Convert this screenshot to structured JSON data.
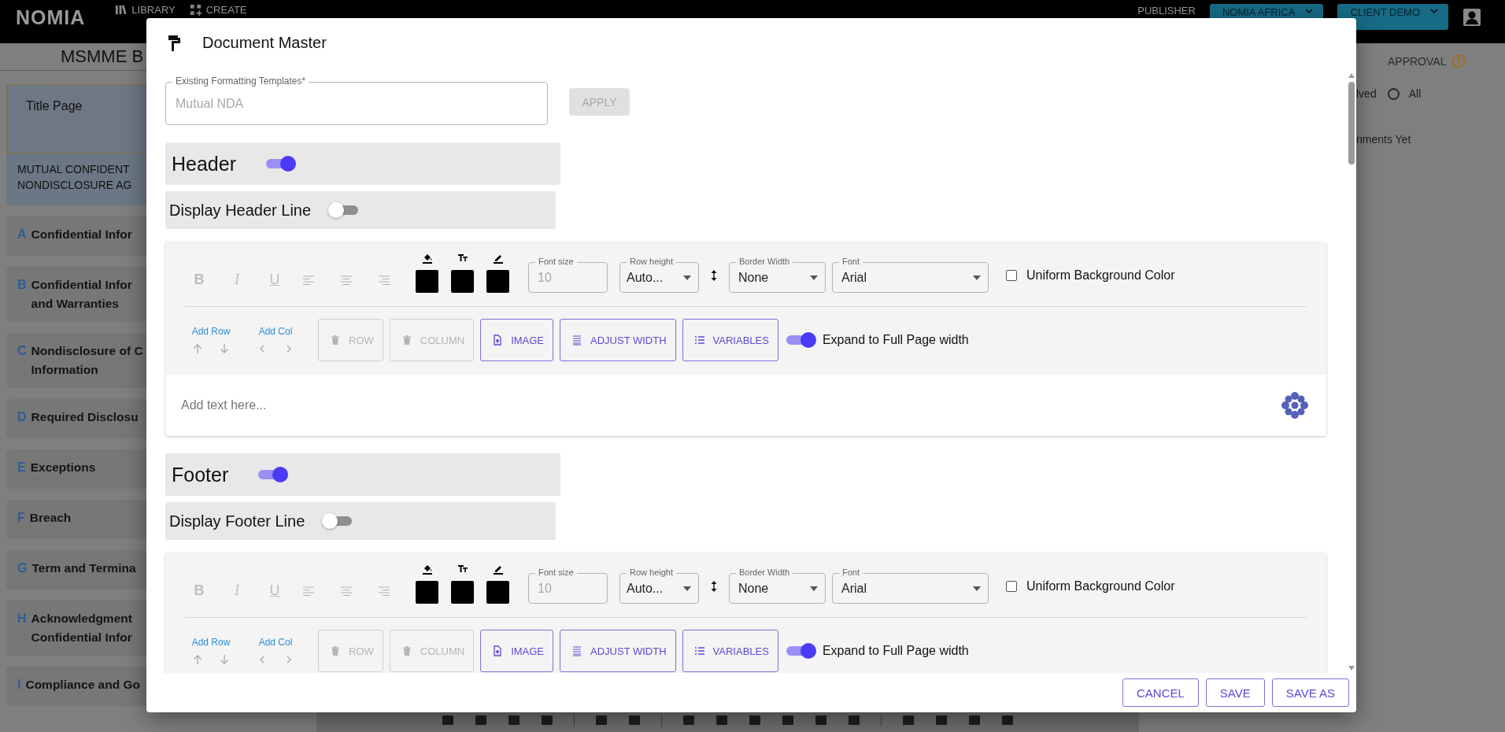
{
  "app_bar": {
    "logo": "NOMIA",
    "nav": [
      {
        "label": "LIBRARY"
      },
      {
        "label": "CREATE"
      }
    ],
    "role": "PUBLISHER",
    "menus": [
      {
        "label": "NOMIA AFRICA"
      },
      {
        "label": "CLIENT DEMO"
      }
    ]
  },
  "document": {
    "title": "MSMME B",
    "title_card": "Title Page",
    "cover_lines": [
      "MUTUAL CONFIDENT",
      "NONDISCLOSURE AG"
    ],
    "sections": [
      {
        "letter": "A",
        "lines": [
          "Confidential Infor"
        ]
      },
      {
        "letter": "B",
        "lines": [
          "Confidential Infor",
          "and Warranties"
        ]
      },
      {
        "letter": "C",
        "lines": [
          "Nondisclosure of C",
          "Information"
        ]
      },
      {
        "letter": "D",
        "lines": [
          "Required Disclosu"
        ]
      },
      {
        "letter": "E",
        "lines": [
          "Exceptions"
        ]
      },
      {
        "letter": "F",
        "lines": [
          "Breach"
        ]
      },
      {
        "letter": "G",
        "lines": [
          "Term and Termina"
        ]
      },
      {
        "letter": "H",
        "lines": [
          "Acknowledgment",
          "Confidential Infor"
        ]
      },
      {
        "letter": "I",
        "lines": [
          "Compliance and Go"
        ]
      }
    ]
  },
  "comments_panel": {
    "approval": "APPROVAL",
    "filter_fragment": "lved",
    "filter": {
      "label": "All",
      "selected": false
    },
    "empty_text": "nments Yet"
  },
  "dialog": {
    "title": "Document Master",
    "template_field": {
      "label": "Existing Formatting Templates*",
      "value": "Mutual NDA",
      "disabled": true
    },
    "apply_button": {
      "label": "APPLY",
      "disabled": true
    },
    "sections": [
      {
        "title": "Header",
        "on": true,
        "line_toggle": {
          "label": "Display Header Line",
          "on": false
        },
        "editor": {
          "format_buttons": [
            "B",
            "I",
            "U"
          ],
          "format_disabled": true,
          "colors": [
            {
              "color": "#000000"
            },
            {
              "color": "#000000"
            },
            {
              "color": "#000000"
            }
          ],
          "font_size": {
            "label": "Font size",
            "value": "10",
            "disabled": true
          },
          "row_height": {
            "label": "Row height",
            "value": "Auto..."
          },
          "border_width": {
            "label": "Border Width",
            "value": "None"
          },
          "font": {
            "label": "Font",
            "value": "Arial"
          },
          "uniform_bg": {
            "label": "Uniform Background Color",
            "checked": false
          },
          "add_row": "Add Row",
          "add_col": "Add Col",
          "actions": [
            {
              "label": "ROW",
              "disabled": true
            },
            {
              "label": "COLUMN",
              "disabled": true
            },
            {
              "label": "IMAGE",
              "disabled": false
            },
            {
              "label": "ADJUST WIDTH",
              "disabled": false
            },
            {
              "label": "VARIABLES",
              "disabled": false
            }
          ],
          "expand": {
            "label": "Expand to Full Page width",
            "on": true
          },
          "placeholder": "Add text here..."
        }
      },
      {
        "title": "Footer",
        "on": true,
        "line_toggle": {
          "label": "Display Footer Line",
          "on": false
        },
        "editor": {
          "format_buttons": [
            "B",
            "I",
            "U"
          ],
          "format_disabled": true,
          "colors": [
            {
              "color": "#000000"
            },
            {
              "color": "#000000"
            },
            {
              "color": "#000000"
            }
          ],
          "font_size": {
            "label": "Font size",
            "value": "10",
            "disabled": true
          },
          "row_height": {
            "label": "Row height",
            "value": "Auto..."
          },
          "border_width": {
            "label": "Border Width",
            "value": "None"
          },
          "font": {
            "label": "Font",
            "value": "Arial"
          },
          "uniform_bg": {
            "label": "Uniform Background Color",
            "checked": false
          },
          "add_row": "Add Row",
          "add_col": "Add Col",
          "actions": [
            {
              "label": "ROW",
              "disabled": true
            },
            {
              "label": "COLUMN",
              "disabled": true
            },
            {
              "label": "IMAGE",
              "disabled": false
            },
            {
              "label": "ADJUST WIDTH",
              "disabled": false
            },
            {
              "label": "VARIABLES",
              "disabled": false
            }
          ],
          "expand": {
            "label": "Expand to Full Page width",
            "on": true
          }
        }
      }
    ],
    "buttons": [
      {
        "label": "CANCEL"
      },
      {
        "label": "SAVE"
      },
      {
        "label": "SAVE AS"
      }
    ]
  }
}
